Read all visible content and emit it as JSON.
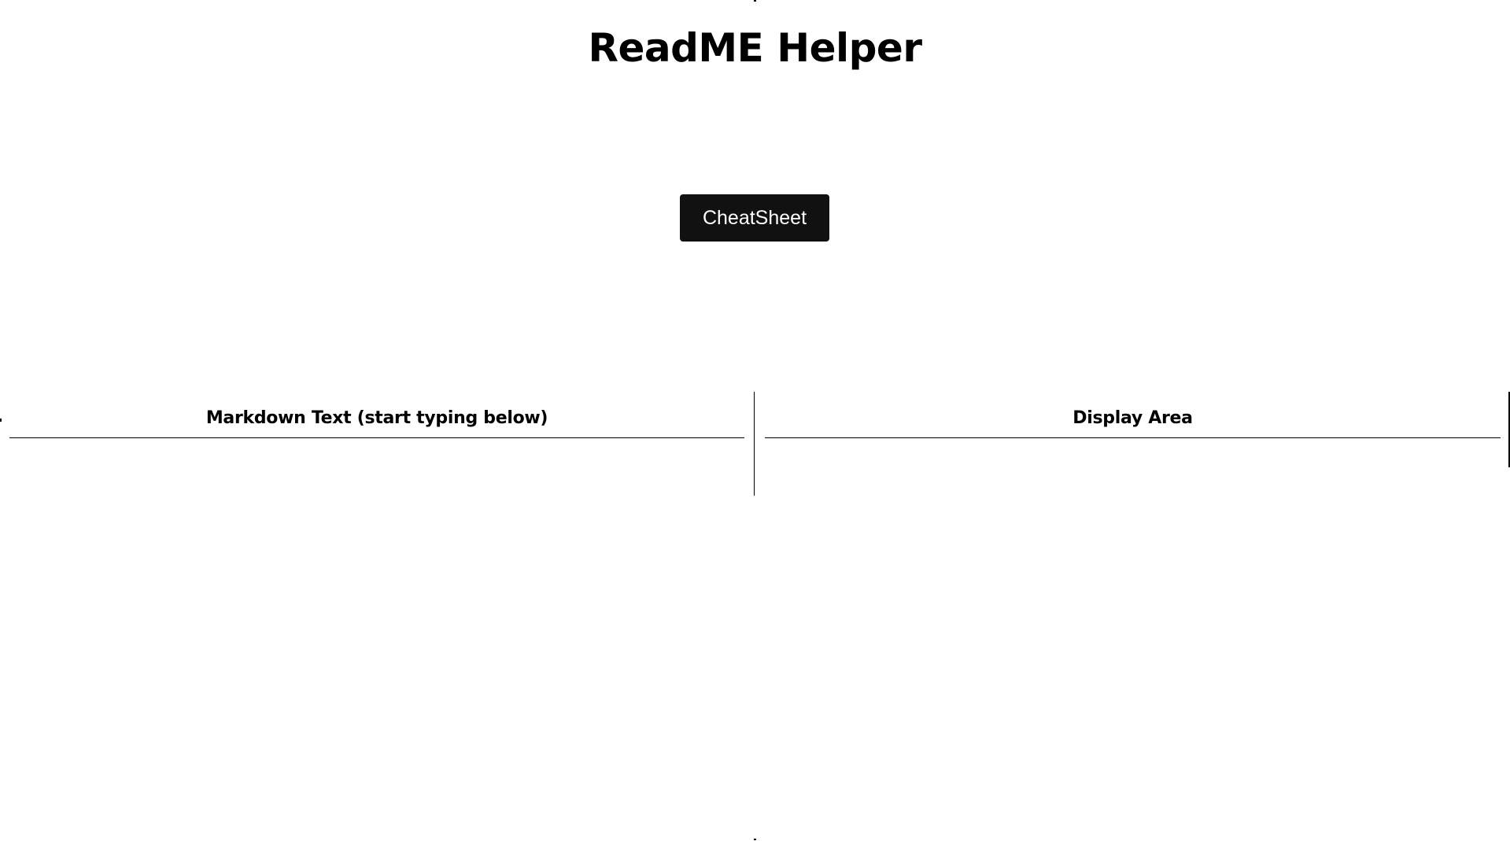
{
  "app": {
    "title": "ReadME Helper"
  },
  "toolbar": {
    "cheatsheet_label": "CheatSheet"
  },
  "editor": {
    "header": "Markdown Text (start typing below)",
    "value": "",
    "placeholder": ""
  },
  "preview": {
    "header": "Display Area",
    "content": ""
  },
  "colors": {
    "button_background": "#111111",
    "button_text": "#ffffff",
    "divider": "#000000",
    "background": "#ffffff"
  }
}
